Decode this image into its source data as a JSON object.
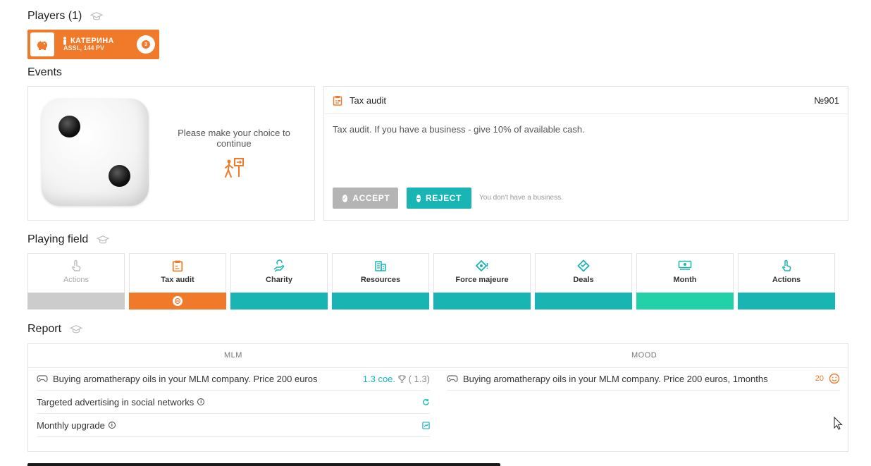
{
  "players": {
    "title": "Players (1)",
    "card": {
      "name": "КАТЕРИНА",
      "sub": "ASSI., 144 PV",
      "badge": "3"
    }
  },
  "events": {
    "title": "Events",
    "dice_value": 2,
    "choice_text": "Please make your choice to continue",
    "card": {
      "title": "Tax audit",
      "number": "№901",
      "description": "Tax audit. If you have a business - give 10% of available cash.",
      "accept_label": "ACCEPT",
      "reject_label": "REJECT",
      "hint": "You don't have a business."
    }
  },
  "field": {
    "title": "Playing field",
    "tiles": [
      {
        "label": "Actions",
        "state": "disabled",
        "color": "#cccccc"
      },
      {
        "label": "Tax audit",
        "state": "current",
        "color": "#f07a2a"
      },
      {
        "label": "Charity",
        "state": "normal",
        "color": "#19b5b5"
      },
      {
        "label": "Resources",
        "state": "normal",
        "color": "#19b5b5"
      },
      {
        "label": "Force majeure",
        "state": "normal",
        "color": "#19b5b5"
      },
      {
        "label": "Deals",
        "state": "normal",
        "color": "#19b5b5"
      },
      {
        "label": "Month",
        "state": "normal",
        "color": "#22d1a8"
      },
      {
        "label": "Actions",
        "state": "normal",
        "color": "#19b5b5"
      }
    ]
  },
  "report": {
    "title": "Report",
    "mlm_header": "MLM",
    "mood_header": "MOOD",
    "mlm_rows": [
      {
        "text": "Buying aromatherapy oils in your MLM company. Price 200 euros",
        "value": "1.3 coe.",
        "trophy_value": "(  1.3)"
      },
      {
        "text": "Targeted advertising in social networks"
      },
      {
        "text": "Monthly upgrade"
      }
    ],
    "mood_rows": [
      {
        "text": "Buying aromatherapy oils in your MLM company. Price 200 euros, 1months",
        "value": "20"
      }
    ]
  },
  "colors": {
    "orange": "#f07a2a",
    "teal": "#19b5b5",
    "green": "#22d1a8",
    "gray": "#b4b4b4"
  }
}
